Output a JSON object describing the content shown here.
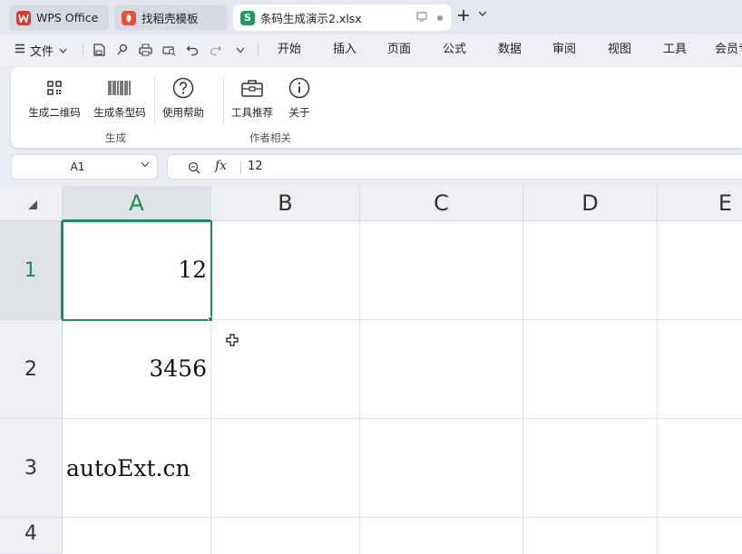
{
  "tabs": [
    {
      "label": "WPS Office",
      "logo_icon": "wps-logo-icon",
      "logo_color": "#e2362b"
    },
    {
      "label": "找稻壳模板",
      "logo_icon": "docer-logo-icon",
      "logo_color": "#e8503a"
    },
    {
      "label": "条码生成演示2.xlsx",
      "logo_icon": "spreadsheet-logo-icon",
      "logo_glyph": "S",
      "logo_color": "#1a9e5c"
    }
  ],
  "menubar": {
    "file_label": "文件",
    "tabs": [
      "开始",
      "插入",
      "页面",
      "公式",
      "数据",
      "审阅",
      "视图",
      "工具",
      "会员专"
    ]
  },
  "ribbon": {
    "buttons": [
      {
        "label": "生成二维码",
        "icon": "qr-code-icon"
      },
      {
        "label": "生成条型码",
        "icon": "barcode-icon"
      },
      {
        "label": "使用帮助",
        "icon": "help-icon"
      },
      {
        "label": "工具推荐",
        "icon": "toolbox-icon"
      },
      {
        "label": "关于",
        "icon": "info-icon"
      }
    ],
    "groups": [
      "生成",
      "作者相关"
    ]
  },
  "formula_bar": {
    "cell_ref": "A1",
    "fx_label": "fx",
    "value": "12"
  },
  "sheet": {
    "columns": [
      "A",
      "B",
      "C",
      "D",
      "E"
    ],
    "selected_column": "A",
    "rows": [
      "1",
      "2",
      "3",
      "4"
    ],
    "selected_row": "1",
    "cells": {
      "A1": "12",
      "A2": "3456",
      "A3": "autoExt.cn"
    },
    "accent_color": "#1f8a5c"
  }
}
